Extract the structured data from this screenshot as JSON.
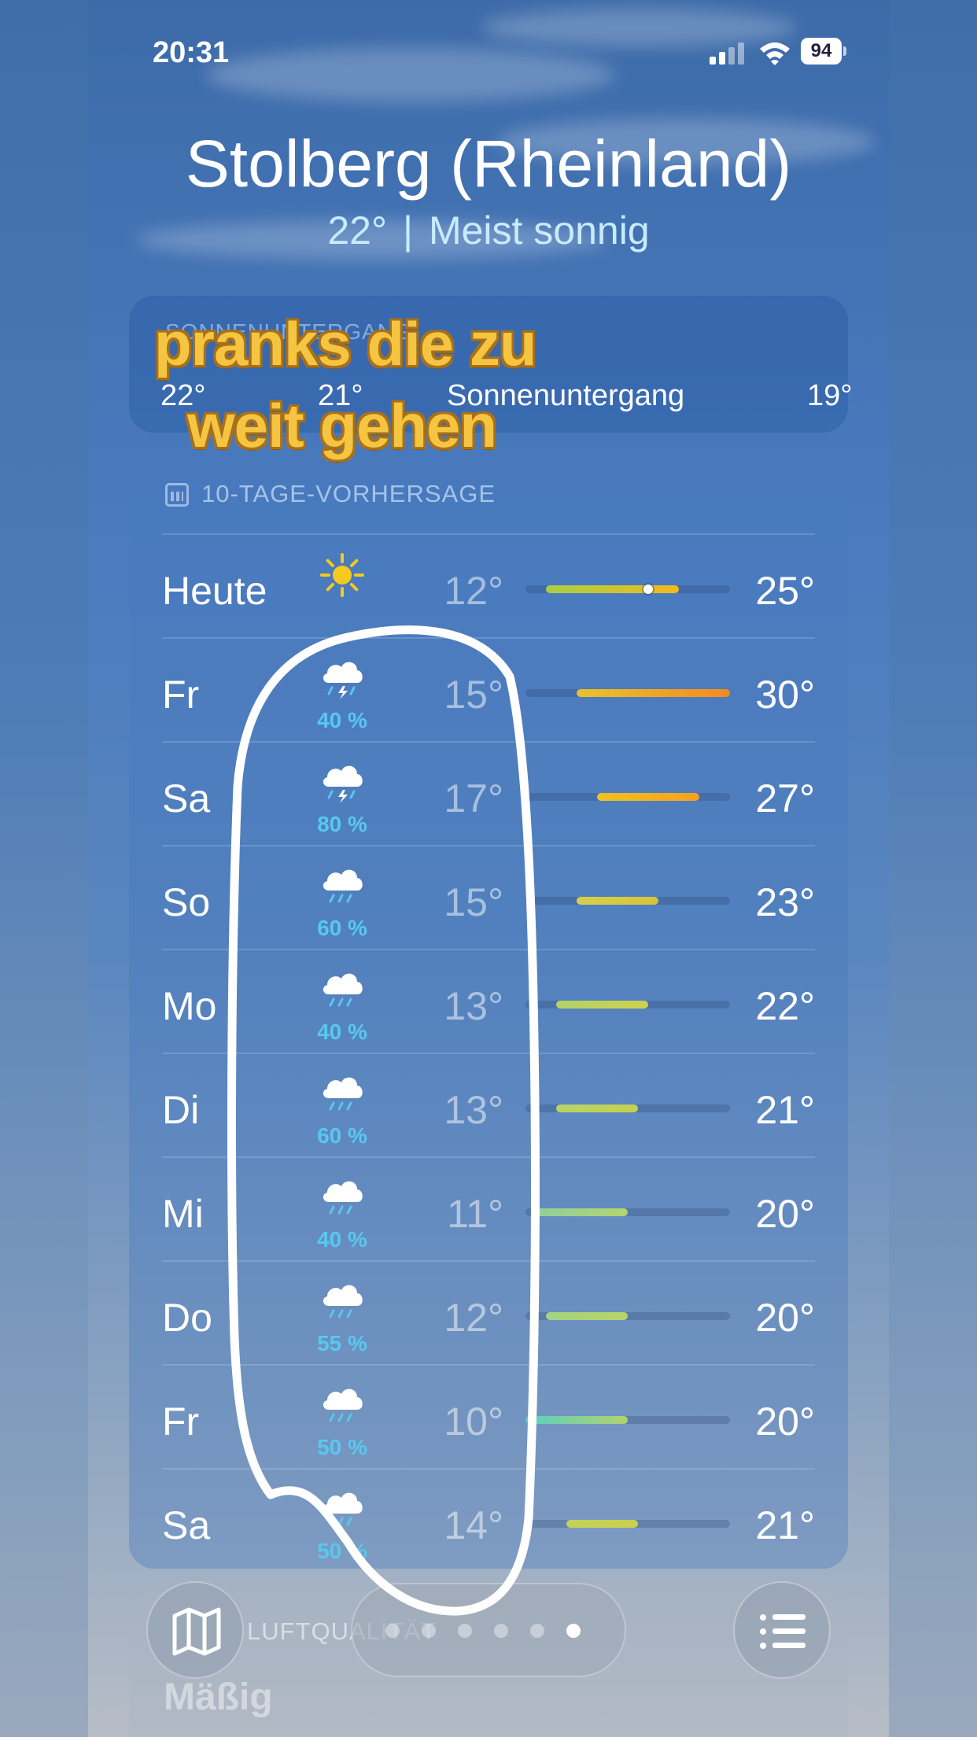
{
  "status_bar": {
    "time": "20:31",
    "battery": "94"
  },
  "location": {
    "city": "Stolberg (Rheinland)",
    "temperature": "22°",
    "separator": "|",
    "condition": "Meist sonnig"
  },
  "hourly": {
    "header": "SONNENUNTERGANG",
    "items": [
      "22°",
      "21°",
      "Sonnenuntergang",
      "19°"
    ]
  },
  "forecast": {
    "header": "10-TAGE-VORHERSAGE",
    "days": [
      {
        "day": "Heute",
        "icon": "sun-icon",
        "precip": "",
        "low": "12°",
        "high": "25°",
        "low_v": 12,
        "high_v": 25,
        "current_v": 22,
        "color": "#a8cf44",
        "color2": "#f2b91c"
      },
      {
        "day": "Fr",
        "icon": "thunderstorm-icon",
        "precip": "40 %",
        "low": "15°",
        "high": "30°",
        "low_v": 15,
        "high_v": 30,
        "color": "#e8c32a",
        "color2": "#f58a1e"
      },
      {
        "day": "Sa",
        "icon": "thunderstorm-icon",
        "precip": "80 %",
        "low": "17°",
        "high": "27°",
        "low_v": 17,
        "high_v": 27,
        "color": "#f0c020",
        "color2": "#f5a020"
      },
      {
        "day": "So",
        "icon": "rain-icon",
        "precip": "60 %",
        "low": "15°",
        "high": "23°",
        "low_v": 15,
        "high_v": 23,
        "color": "#d6d04a",
        "color2": "#d8c43a"
      },
      {
        "day": "Mo",
        "icon": "rain-icon",
        "precip": "40 %",
        "low": "13°",
        "high": "22°",
        "low_v": 13,
        "high_v": 22,
        "color": "#b2d36a",
        "color2": "#cfd14c"
      },
      {
        "day": "Di",
        "icon": "rain-icon",
        "precip": "60 %",
        "low": "13°",
        "high": "21°",
        "low_v": 13,
        "high_v": 21,
        "color": "#b6d568",
        "color2": "#c8d050"
      },
      {
        "day": "Mi",
        "icon": "rain-icon",
        "precip": "40 %",
        "low": "11°",
        "high": "20°",
        "low_v": 11,
        "high_v": 20,
        "color": "#8ed19a",
        "color2": "#b4d470"
      },
      {
        "day": "Do",
        "icon": "rain-icon",
        "precip": "55 %",
        "low": "12°",
        "high": "20°",
        "low_v": 12,
        "high_v": 20,
        "color": "#a4d380",
        "color2": "#b8d466"
      },
      {
        "day": "Fr",
        "icon": "rain-icon",
        "precip": "50 %",
        "low": "10°",
        "high": "20°",
        "low_v": 10,
        "high_v": 20,
        "color": "#5ccfc0",
        "color2": "#b0d26c"
      },
      {
        "day": "Sa",
        "icon": "rain-icon",
        "precip": "50 %",
        "low": "14°",
        "high": "21°",
        "low_v": 14,
        "high_v": 21,
        "color": "#c2d25a",
        "color2": "#cad04e"
      }
    ],
    "range_min": 10,
    "range_max": 30
  },
  "air_quality": {
    "header": "LUFTQUALITÄT",
    "value": "Mäßig"
  },
  "pager": {
    "count": 6,
    "active": 5
  },
  "overlay": {
    "line1": "pranks die zu",
    "line2": "weit gehen"
  }
}
